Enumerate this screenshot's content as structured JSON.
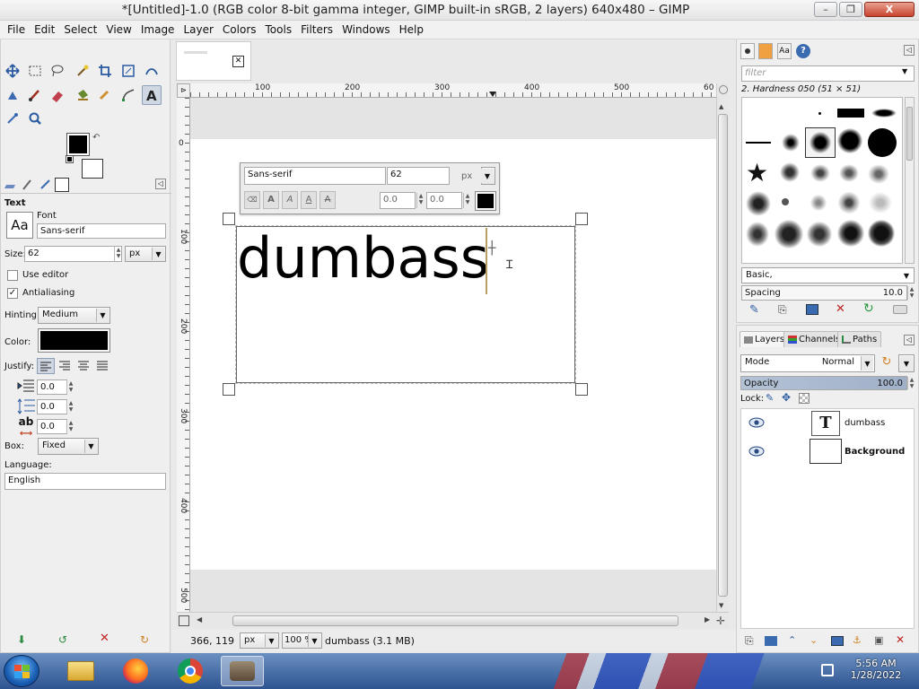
{
  "window": {
    "title": "*[Untitled]-1.0 (RGB color 8-bit gamma integer, GIMP built-in sRGB, 2 layers) 640x480 – GIMP",
    "min_glyph": "–",
    "max_glyph": "❐",
    "close_glyph": "X"
  },
  "menu": [
    "File",
    "Edit",
    "Select",
    "View",
    "Image",
    "Layer",
    "Colors",
    "Tools",
    "Filters",
    "Windows",
    "Help"
  ],
  "tool_options": {
    "section_title": "Text",
    "font_label": "Font",
    "font_preview": "Aa",
    "font_value": "Sans-serif",
    "size_label": "Size:",
    "size_value": "62",
    "size_unit": "px",
    "use_editor_label": "Use editor",
    "use_editor_checked": false,
    "antialiasing_label": "Antialiasing",
    "antialiasing_checked": true,
    "hinting_label": "Hinting:",
    "hinting_value": "Medium",
    "color_label": "Color:",
    "color_value": "#000000",
    "justify_label": "Justify:",
    "indent_value": "0.0",
    "line_spacing_value": "0.0",
    "letter_spacing_value": "0.0",
    "letter_spacing_glyph": "ab",
    "box_label": "Box:",
    "box_value": "Fixed",
    "language_label": "Language:",
    "language_value": "English"
  },
  "canvas": {
    "text_content": "dumbass",
    "ruler_ticks_h": [
      "100",
      "200",
      "300",
      "400",
      "500",
      "60"
    ],
    "ruler_ticks_v": [
      "0",
      "100",
      "200",
      "300",
      "400",
      "500"
    ],
    "text_toolbar": {
      "font": "Sans-serif",
      "size": "62",
      "unit": "px",
      "baseline": "0.0",
      "kerning": "0.0",
      "color": "#000000"
    }
  },
  "statusbar": {
    "coords": "366, 119",
    "unit": "px",
    "zoom": "100 %",
    "info": "dumbass (3.1 MB)"
  },
  "brushes": {
    "filter_placeholder": "filter",
    "current_brush": "2. Hardness 050 (51 × 51)",
    "preset": "Basic,",
    "spacing_label": "Spacing",
    "spacing_value": "10.0"
  },
  "layers": {
    "tabs": [
      "Layers",
      "Channels",
      "Paths"
    ],
    "mode_label": "Mode",
    "mode_value": "Normal",
    "opacity_label": "Opacity",
    "opacity_value": "100.0",
    "lock_label": "Lock:",
    "items": [
      {
        "name": "dumbass",
        "type": "text",
        "thumb_glyph": "T"
      },
      {
        "name": "Background",
        "type": "image",
        "thumb_glyph": ""
      }
    ]
  },
  "taskbar": {
    "time": "5:56 AM",
    "date": "1/28/2022"
  },
  "colors": {
    "accent": "#2e5390",
    "selection": "#cfd7e3",
    "foreground": "#000000",
    "background": "#ffffff"
  }
}
